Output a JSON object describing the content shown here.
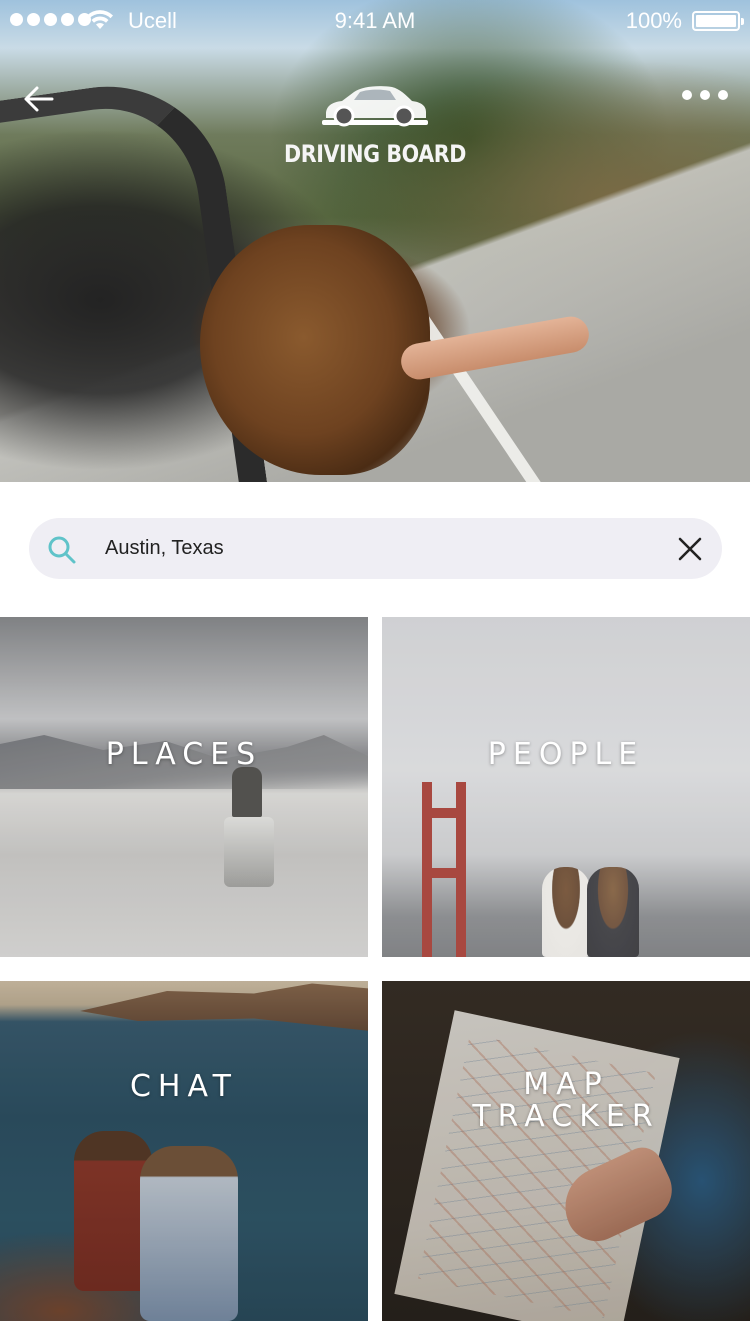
{
  "status_bar": {
    "carrier": "Ucell",
    "time": "9:41 AM",
    "battery": "100%"
  },
  "header": {
    "app_name": "DRIVING BOARD",
    "icons": {
      "back": "arrow-left-icon",
      "more": "more-dots-icon",
      "logo": "car-icon"
    }
  },
  "search": {
    "value": "Austin, Texas",
    "placeholder": "",
    "icon": "search-icon",
    "accent_color": "#5fc3c9",
    "clear_icon": "close-icon"
  },
  "tiles": [
    {
      "label_lines": [
        "PLACES"
      ]
    },
    {
      "label_lines": [
        "PEOPLE"
      ]
    },
    {
      "label_lines": [
        "CHAT"
      ]
    },
    {
      "label_lines": [
        "MAP",
        "TRACKER"
      ]
    }
  ],
  "colors": {
    "search_background": "#efeef4",
    "text_light": "#ffffff"
  }
}
